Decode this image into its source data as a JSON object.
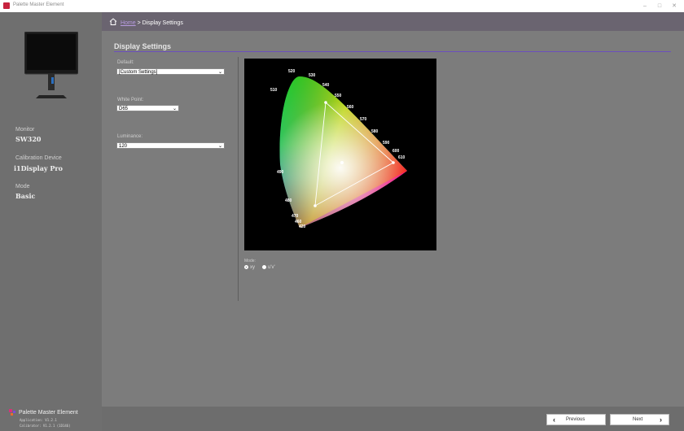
{
  "window": {
    "title": "Palette Master Element",
    "controls": [
      "–",
      "□",
      "✕"
    ]
  },
  "sidebar": {
    "monitor_label": "Monitor",
    "monitor_value": "SW320",
    "device_label": "Calibration Device",
    "device_value": "i1Display Pro",
    "mode_label": "Mode",
    "mode_value": "Basic",
    "brand": "Palette Master Element",
    "app_version": "Application: V1.2.1",
    "calibrator_version": "Calibrator: V1.2.1 (1D146)"
  },
  "breadcrumb": {
    "home": "Home",
    "separator": ">",
    "current": "Display Settings"
  },
  "page": {
    "title": "Display Settings"
  },
  "form": {
    "default_label": "Default:",
    "default_value": "[Custom Settings]",
    "white_point_label": "White Point:",
    "white_point_value": "D65",
    "luminance_label": "Luminance:",
    "luminance_value": "120",
    "mode_label": "Mode:",
    "mode_options": [
      {
        "label": "xy",
        "selected": true
      },
      {
        "label": "u'v'",
        "selected": false
      }
    ]
  },
  "chart_data": {
    "type": "scatter",
    "title": "",
    "wavelength_labels": [
      "420",
      "460",
      "470",
      "480",
      "490",
      "510",
      "520",
      "530",
      "540",
      "550",
      "560",
      "570",
      "580",
      "590",
      "600",
      "610"
    ],
    "gamut_triangle": [
      {
        "x": 0.64,
        "y": 0.33
      },
      {
        "x": 0.3,
        "y": 0.6
      },
      {
        "x": 0.15,
        "y": 0.06
      }
    ],
    "white_point": {
      "x": 0.3127,
      "y": 0.329
    }
  },
  "footer": {
    "previous_label": "Previous",
    "next_label": "Next"
  },
  "colors": {
    "accent": "#6c4fbd",
    "breadcrumb_bar": "#6a6470",
    "background": "#7c7c7c"
  }
}
